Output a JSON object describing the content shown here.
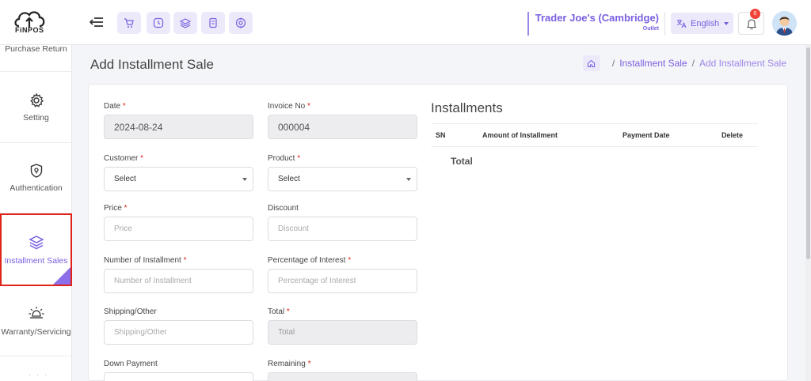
{
  "app": {
    "logo_text": "FiNPOS"
  },
  "header": {
    "store_name": "Trader Joe's (Cambridge)",
    "store_type": "Outlet",
    "language": "English",
    "notification_count": "0",
    "quick_icons": [
      "cart-icon",
      "clock-icon",
      "layers-icon",
      "receipt-icon",
      "target-icon"
    ]
  },
  "sidebar": {
    "items": [
      {
        "label": "Purchase Return",
        "icon": "return-icon"
      },
      {
        "label": "Setting",
        "icon": "gear-icon"
      },
      {
        "label": "Authentication",
        "icon": "shield-icon"
      },
      {
        "label": "Installment Sales",
        "icon": "layers-icon",
        "active": true
      },
      {
        "label": "Warranty/Servicing",
        "icon": "lamp-icon"
      }
    ],
    "more": "· · ·"
  },
  "page": {
    "title": "Add Installment Sale",
    "breadcrumb": [
      "Installment Sale",
      "Add Installment Sale"
    ]
  },
  "form": {
    "date": {
      "label": "Date",
      "value": "2024-08-24"
    },
    "invoice": {
      "label": "Invoice No",
      "value": "000004"
    },
    "customer": {
      "label": "Customer",
      "value": "Select"
    },
    "product": {
      "label": "Product",
      "value": "Select"
    },
    "price": {
      "label": "Price",
      "placeholder": "Price"
    },
    "discount": {
      "label": "Discount",
      "placeholder": "Discount"
    },
    "num_installment": {
      "label": "Number of Installment",
      "placeholder": "Number of Installment"
    },
    "interest": {
      "label": "Percentage of Interest",
      "placeholder": "Percentage of Interest"
    },
    "shipping": {
      "label": "Shipping/Other",
      "placeholder": "Shipping/Other"
    },
    "total": {
      "label": "Total",
      "placeholder": "Total"
    },
    "down_payment": {
      "label": "Down Payment"
    },
    "remaining": {
      "label": "Remaining"
    }
  },
  "installments": {
    "title": "Installments",
    "columns": [
      "SN",
      "Amount of Installment",
      "Payment Date",
      "Delete"
    ],
    "total_label": "Total"
  }
}
